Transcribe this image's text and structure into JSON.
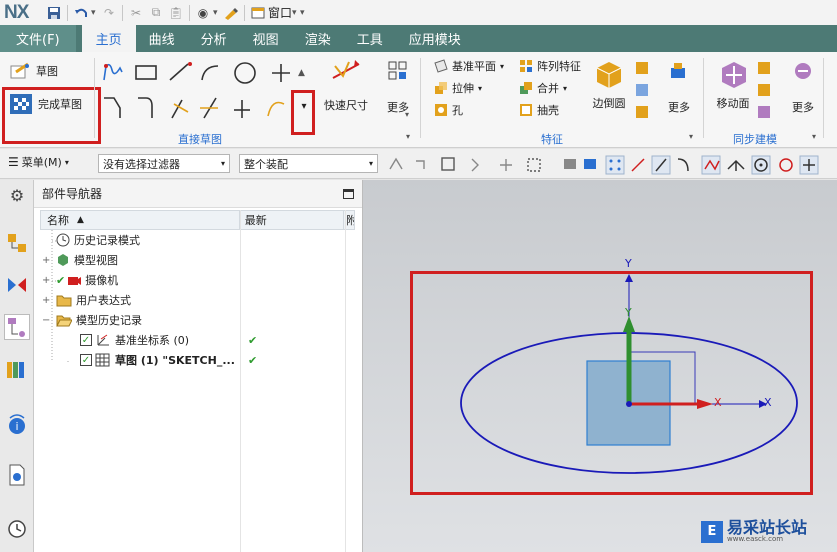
{
  "app": {
    "logo": "NX"
  },
  "quick_access": {
    "window_label": "窗口"
  },
  "tabs": [
    {
      "label": "文件(F)"
    },
    {
      "label": "主页"
    },
    {
      "label": "曲线"
    },
    {
      "label": "分析"
    },
    {
      "label": "视图"
    },
    {
      "label": "渲染"
    },
    {
      "label": "工具"
    },
    {
      "label": "应用模块"
    }
  ],
  "ribbon": {
    "sketch_label": "草图",
    "finish_sketch_label": "完成草图",
    "direct_sketch_group": "直接草图",
    "quick_dimension_label": "快速尺寸",
    "more_label": "更多",
    "feature_group": "特征",
    "datum_plane_label": "基准平面",
    "extrude_label": "拉伸",
    "hole_label": "孔",
    "pattern_feature_label": "阵列特征",
    "unite_label": "合并",
    "shell_label": "抽壳",
    "edge_blend_label": "边倒圆",
    "more_label_2": "更多",
    "sync_group": "同步建模",
    "move_face_label": "移动面",
    "more_label_3": "更多"
  },
  "toolbar": {
    "menu_label": "菜单(M)",
    "filter_value": "没有选择过滤器",
    "assembly_value": "整个装配"
  },
  "navigator": {
    "title": "部件导航器",
    "col_name": "名称",
    "col_latest": "最新",
    "col_extra": "附",
    "rows": [
      {
        "label": "历史记录模式"
      },
      {
        "label": "模型视图"
      },
      {
        "label": "摄像机"
      },
      {
        "label": "用户表达式"
      },
      {
        "label": "模型历史记录"
      },
      {
        "label": "基准坐标系 (0)"
      },
      {
        "label": "草图 (1) \"SKETCH_..."
      }
    ]
  },
  "canvas": {
    "axis_y": "Y",
    "axis_y2": "Y",
    "axis_x": "X",
    "axis_x2": "X",
    "watermark": "易采站长站",
    "watermark_sub": "www.easck.com"
  },
  "colors": {
    "tabbar": "#4d7a75",
    "active_tab_text": "#2a6fd0",
    "highlight": "#d01f1f",
    "ellipse": "#1a1ab8",
    "square_fill": "#8fb2cf"
  }
}
